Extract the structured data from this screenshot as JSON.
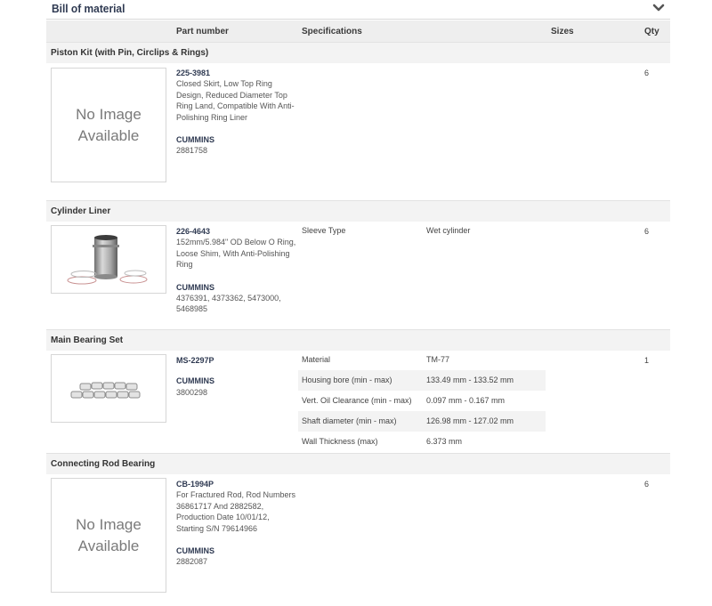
{
  "panel": {
    "title": "Bill of material",
    "collapse_icon": "chevron-down-icon"
  },
  "columns": {
    "part_number": "Part number",
    "specifications": "Specifications",
    "sizes": "Sizes",
    "qty": "Qty"
  },
  "groups": [
    {
      "name": "Piston Kit (with Pin, Circlips & Rings)",
      "image": "No Image Available",
      "part_number": "225-3981",
      "description": "Closed Skirt, Low Top Ring Design, Reduced Diameter Top Ring Land, Compatible With Anti-Polishing Ring Liner",
      "brand": "CUMMINS",
      "refs": "2881758",
      "qty": "6",
      "specs": []
    },
    {
      "name": "Cylinder Liner",
      "image": "cylinder-liner-photo",
      "part_number": "226-4643",
      "description": "152mm/5.984\" OD Below O Ring, Loose Shim, With Anti-Polishing Ring",
      "brand": "CUMMINS",
      "refs": "4376391, 4373362, 5473000, 5468985",
      "qty": "6",
      "specs": [
        {
          "key": "Sleeve Type",
          "value": "Wet cylinder"
        }
      ]
    },
    {
      "name": "Main Bearing Set",
      "image": "main-bearing-set-photo",
      "part_number": "MS-2297P",
      "description": "",
      "brand": "CUMMINS",
      "refs": "3800298",
      "qty": "1",
      "specs": [
        {
          "key": "Material",
          "value": "TM-77"
        },
        {
          "key": "Housing bore (min - max)",
          "value": "133.49 mm - 133.52 mm"
        },
        {
          "key": "Vert. Oil Clearance (min - max)",
          "value": "0.097 mm - 0.167 mm"
        },
        {
          "key": "Shaft diameter (min - max)",
          "value": "126.98 mm - 127.02 mm"
        },
        {
          "key": "Wall Thickness (max)",
          "value": "6.373 mm"
        }
      ]
    },
    {
      "name": "Connecting Rod Bearing",
      "image": "No Image Available",
      "part_number": "CB-1994P",
      "description": "For Fractured Rod, Rod Numbers 36861717 And 2882582, Production Date 10/01/12, Starting S/N 79614966",
      "brand": "CUMMINS",
      "refs": "2882087",
      "qty": "6",
      "specs": []
    }
  ]
}
